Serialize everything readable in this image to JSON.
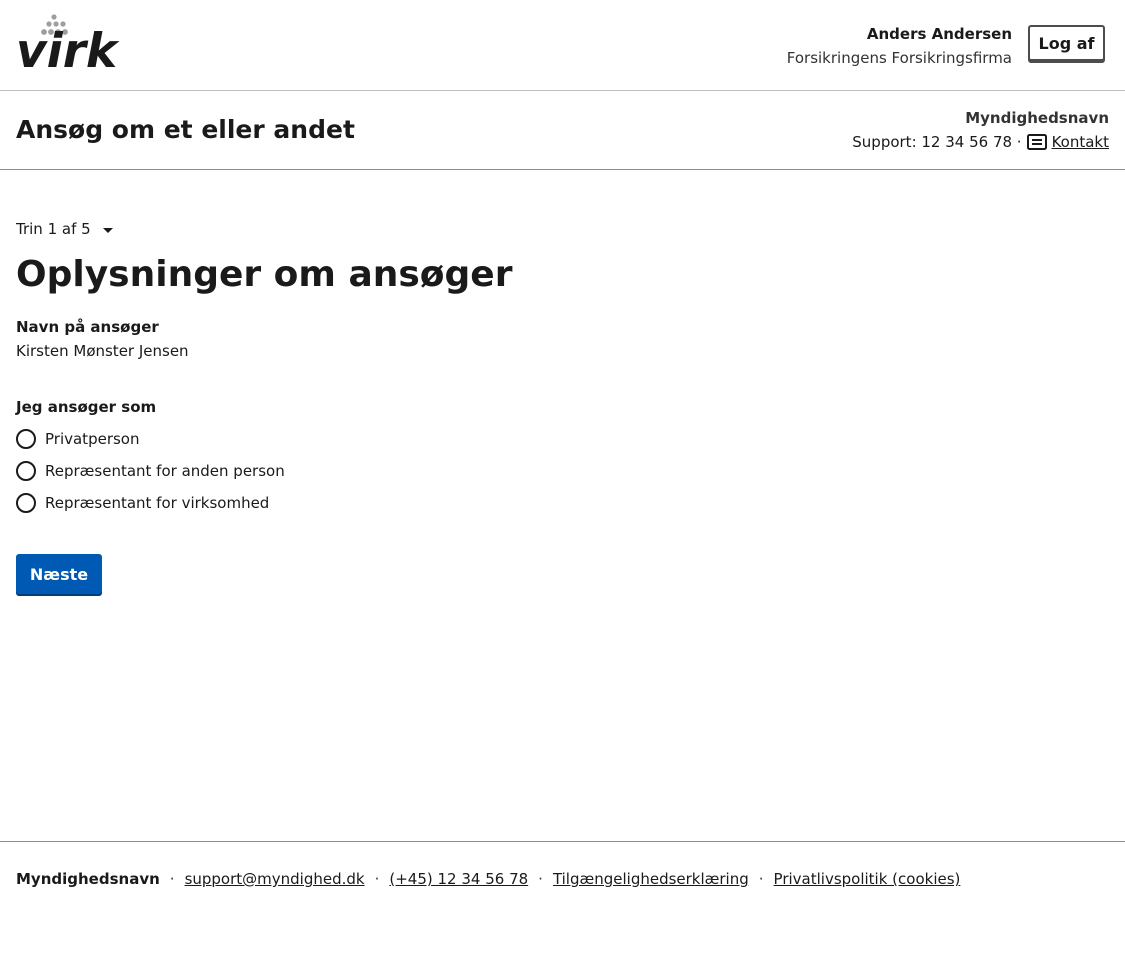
{
  "header": {
    "logo_text": "virk",
    "user_name": "Anders Andersen",
    "user_org": "Forsikringens Forsikringsfirma",
    "logout_label": "Log af"
  },
  "service": {
    "title": "Ansøg om et eller andet",
    "authority_name": "Myndighedsnavn",
    "support_text": "Support: 12 34 56 78 ·",
    "contact_label": "Kontakt"
  },
  "main": {
    "step_label": "Trin 1 af 5",
    "page_title": "Oplysninger om ansøger",
    "applicant_label": "Navn på ansøger",
    "applicant_value": "Kirsten Mønster Jensen",
    "role_legend": "Jeg ansøger som",
    "role_options": [
      {
        "label": "Privatperson",
        "selected": false
      },
      {
        "label": "Repræsentant for anden person",
        "selected": false
      },
      {
        "label": "Repræsentant for virksomhed",
        "selected": false
      }
    ],
    "next_label": "Næste"
  },
  "footer": {
    "authority_name": "Myndighedsnavn",
    "email": "support@myndighed.dk",
    "phone": "(+45) 12 34 56 78",
    "accessibility": "Tilgængelighedserklæring",
    "privacy": "Privatlivspolitik (cookies)",
    "separator": "·"
  },
  "colors": {
    "primary": "#0059b3",
    "text": "#1a1a1a",
    "border": "#bfbfbf",
    "logo_dots": "#9e9e9e"
  }
}
